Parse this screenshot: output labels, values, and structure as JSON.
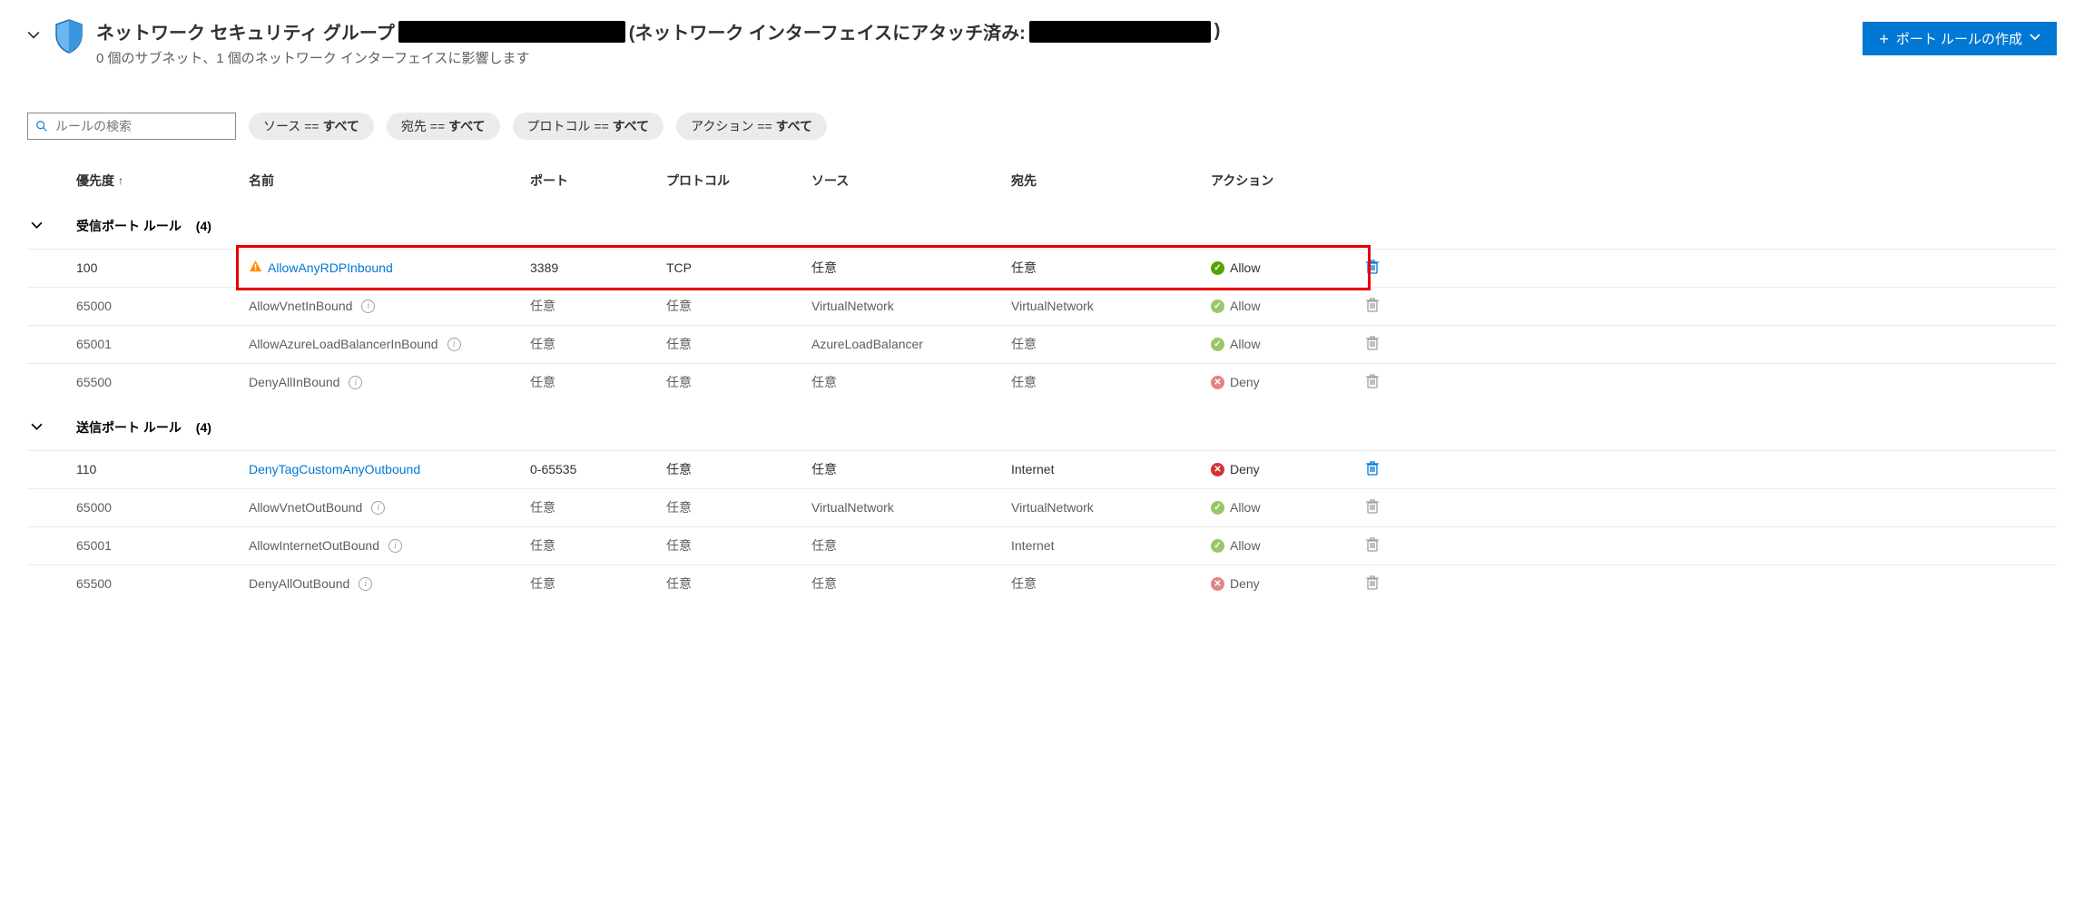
{
  "header": {
    "title_prefix": "ネットワーク セキュリティ グループ",
    "attached_label": " (ネットワーク インターフェイスにアタッチ済み: ",
    "subtitle": "0 個のサブネット、1 個のネットワーク インターフェイスに影響します",
    "create_button": "ポート ルールの作成"
  },
  "search": {
    "placeholder": "ルールの検索"
  },
  "filters": [
    {
      "label": "ソース == ",
      "value": "すべて"
    },
    {
      "label": "宛先 == ",
      "value": "すべて"
    },
    {
      "label": "プロトコル == ",
      "value": "すべて"
    },
    {
      "label": "アクション == ",
      "value": "すべて"
    }
  ],
  "columns": {
    "priority": "優先度",
    "name": "名前",
    "port": "ポート",
    "protocol": "プロトコル",
    "source": "ソース",
    "destination": "宛先",
    "action": "アクション"
  },
  "sections": {
    "inbound": {
      "title": "受信ポート ルール",
      "count": "(4)"
    },
    "outbound": {
      "title": "送信ポート ルール",
      "count": "(4)"
    }
  },
  "rules": {
    "inbound": [
      {
        "priority": "100",
        "name": "AllowAnyRDPInbound",
        "port": "3389",
        "protocol": "TCP",
        "source": "任意",
        "destination": "任意",
        "action": "Allow",
        "action_type": "allow",
        "default": false,
        "warning": true,
        "highlight": true
      },
      {
        "priority": "65000",
        "name": "AllowVnetInBound",
        "port": "任意",
        "protocol": "任意",
        "source": "VirtualNetwork",
        "destination": "VirtualNetwork",
        "action": "Allow",
        "action_type": "allow",
        "default": true,
        "warning": false,
        "highlight": false
      },
      {
        "priority": "65001",
        "name": "AllowAzureLoadBalancerInBound",
        "port": "任意",
        "protocol": "任意",
        "source": "AzureLoadBalancer",
        "destination": "任意",
        "action": "Allow",
        "action_type": "allow",
        "default": true,
        "warning": false,
        "highlight": false
      },
      {
        "priority": "65500",
        "name": "DenyAllInBound",
        "port": "任意",
        "protocol": "任意",
        "source": "任意",
        "destination": "任意",
        "action": "Deny",
        "action_type": "deny",
        "default": true,
        "warning": false,
        "highlight": false
      }
    ],
    "outbound": [
      {
        "priority": "110",
        "name": "DenyTagCustomAnyOutbound",
        "port": "0-65535",
        "protocol": "任意",
        "source": "任意",
        "destination": "Internet",
        "action": "Deny",
        "action_type": "deny",
        "default": false,
        "warning": false,
        "highlight": false
      },
      {
        "priority": "65000",
        "name": "AllowVnetOutBound",
        "port": "任意",
        "protocol": "任意",
        "source": "VirtualNetwork",
        "destination": "VirtualNetwork",
        "action": "Allow",
        "action_type": "allow",
        "default": true,
        "warning": false,
        "highlight": false
      },
      {
        "priority": "65001",
        "name": "AllowInternetOutBound",
        "port": "任意",
        "protocol": "任意",
        "source": "任意",
        "destination": "Internet",
        "action": "Allow",
        "action_type": "allow",
        "default": true,
        "warning": false,
        "highlight": false
      },
      {
        "priority": "65500",
        "name": "DenyAllOutBound",
        "port": "任意",
        "protocol": "任意",
        "source": "任意",
        "destination": "任意",
        "action": "Deny",
        "action_type": "deny",
        "default": true,
        "warning": false,
        "highlight": false
      }
    ]
  }
}
